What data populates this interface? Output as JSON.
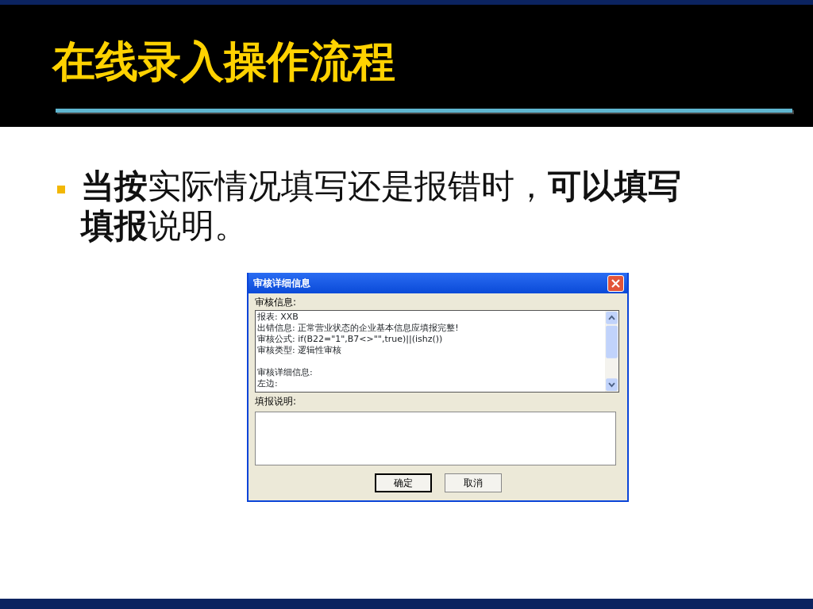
{
  "slide": {
    "title": "在线录入操作流程",
    "bullets": [
      "**当按**实际情况填写还是报错时，**可以填写填报**说明。"
    ]
  },
  "dialog": {
    "title": "审核详细信息",
    "audit_label": "审核信息:",
    "message_blocks": [
      [
        "报表: XXB",
        "出错信息: 正常营业状态的企业基本信息应填报完整!",
        "审核公式: if(B22=\"1\",B7<>\"\",true)||(ishz())",
        "审核类型: 逻辑性审核"
      ],
      [
        "审核详细信息:",
        "左边:"
      ]
    ],
    "note_label": "填报说明:",
    "buttons": [
      {
        "label": "确定",
        "default": true
      },
      {
        "label": "取消",
        "default": false
      }
    ]
  }
}
